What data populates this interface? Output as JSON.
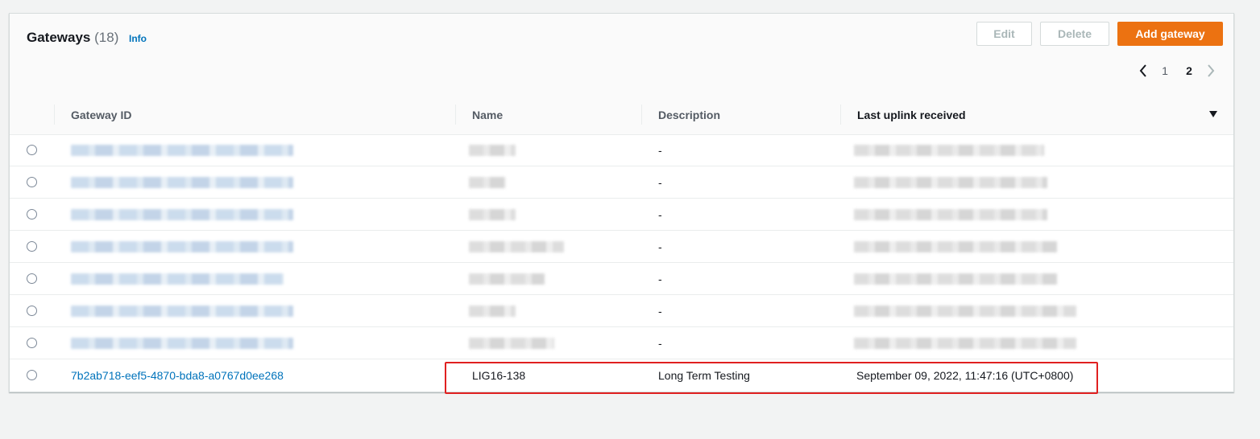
{
  "panel": {
    "title": "Gateways",
    "count": "(18)",
    "info_label": "Info"
  },
  "actions": {
    "edit_label": "Edit",
    "delete_label": "Delete",
    "add_label": "Add gateway"
  },
  "pagination": {
    "pages": [
      "1",
      "2"
    ],
    "current_page": "2"
  },
  "table": {
    "columns": [
      "Gateway ID",
      "Name",
      "Description",
      "Last uplink received"
    ],
    "sorted_column": "Last uplink received",
    "sort_direction": "descending",
    "redacted_rows": [
      {
        "description": "-"
      },
      {
        "description": "-"
      },
      {
        "description": "-"
      },
      {
        "description": "-"
      },
      {
        "description": "-"
      },
      {
        "description": "-"
      },
      {
        "description": "-"
      }
    ],
    "visible_row": {
      "gateway_id": "7b2ab718-eef5-4870-bda8-a0767d0ee268",
      "name": "LIG16-138",
      "description": "Long Term Testing",
      "last_uplink": "September 09, 2022, 11:47:16 (UTC+0800)"
    }
  },
  "colors": {
    "primary": "#ec7211",
    "link": "#0073bb",
    "highlight": "#e02020"
  }
}
